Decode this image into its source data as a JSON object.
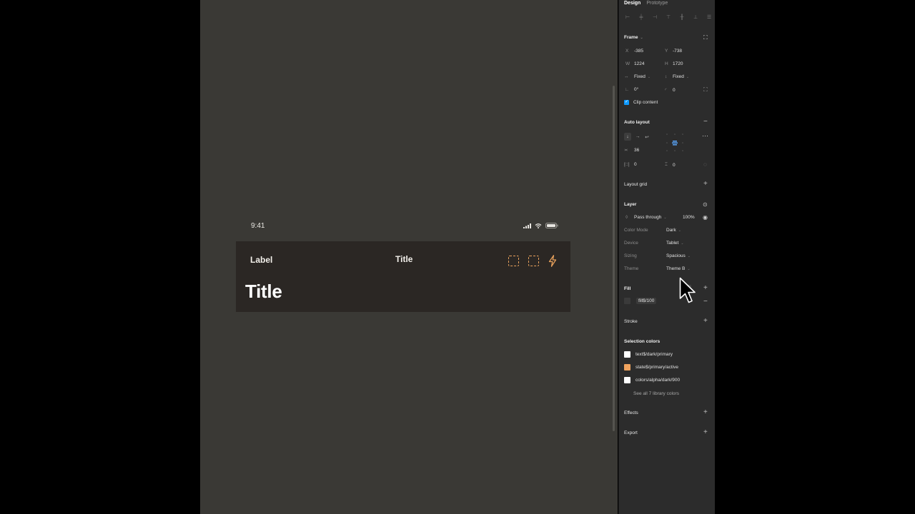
{
  "canvas": {
    "status_time": "9:41",
    "nav": {
      "label": "Label",
      "title_small": "Title",
      "title_large": "Title"
    }
  },
  "panel": {
    "tabs": [
      {
        "label": "Design",
        "active": true
      },
      {
        "label": "Prototype",
        "active": false
      }
    ],
    "frame": {
      "title": "Frame",
      "x_label": "X",
      "x_value": "-385",
      "y_label": "Y",
      "y_value": "-738",
      "w_label": "W",
      "w_value": "1224",
      "h_label": "H",
      "h_value": "1720",
      "w_sizing": "Fixed",
      "h_sizing": "Fixed",
      "rotation": "0°",
      "radius": "0",
      "clip_content": "Clip content"
    },
    "auto_layout": {
      "title": "Auto layout",
      "gap": "36",
      "padding_h": "0",
      "padding_v": "0"
    },
    "layout_grid": {
      "title": "Layout grid"
    },
    "layer": {
      "title": "Layer",
      "blend": "Pass through",
      "opacity": "100%",
      "modes": [
        {
          "label": "Color Mode",
          "value": "Dark"
        },
        {
          "label": "Device",
          "value": "Tablet"
        },
        {
          "label": "Sizing",
          "value": "Spacious"
        },
        {
          "label": "Theme",
          "value": "Theme B"
        }
      ]
    },
    "fill": {
      "title": "Fill",
      "value": "fill$/100"
    },
    "stroke": {
      "title": "Stroke"
    },
    "selection_colors": {
      "title": "Selection colors",
      "items": [
        {
          "name": "text$/dark/primary",
          "color": "#ffffff"
        },
        {
          "name": "state$/primary/active",
          "color": "#f0a35e"
        },
        {
          "name": "colors/alpha/dark/900",
          "color": "#ffffff"
        }
      ],
      "see_all": "See all 7 library colors"
    },
    "effects": {
      "title": "Effects"
    },
    "export": {
      "title": "Export"
    }
  },
  "colors": {
    "canvas_bg": "#3a3935",
    "nav_bg": "#2b2724",
    "accent": "#e8a15c",
    "panel_bg": "#2c2c2c",
    "selection_blue": "#0d99ff"
  }
}
